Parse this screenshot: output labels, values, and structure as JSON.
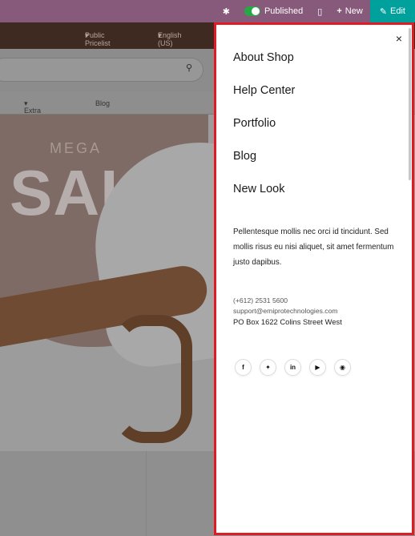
{
  "topbar": {
    "bug_icon": "bug-icon",
    "published_label": "Published",
    "mobile_icon": "mobile-icon",
    "new_label": "New",
    "edit_label": "Edit",
    "colors": {
      "bar": "#875a7b",
      "edit": "#00a09d",
      "toggle": "#28a745"
    }
  },
  "site_header": {
    "pricelist": "Public Pricelist",
    "language": "English (US)"
  },
  "menu": {
    "extra_pages": "Extra Pages",
    "blog": "Blog"
  },
  "hero": {
    "mega": "MEGA",
    "sale": "SALE"
  },
  "offcanvas": {
    "close_label": "×",
    "nav_items": [
      "About Shop",
      "Help Center",
      "Portfolio",
      "Blog",
      "New Look"
    ],
    "description": "Pellentesque mollis nec orci id tincidunt. Sed mollis risus eu nisi aliquet, sit amet fermentum justo dapibus.",
    "phone": "(+612) 2531 5600",
    "email": "support@emiprotechnologies.com",
    "address": "PO Box 1622 Colins Street West",
    "socials": [
      "facebook-icon",
      "twitter-icon",
      "linkedin-icon",
      "youtube-icon",
      "github-icon"
    ],
    "border_color": "#e01b24"
  }
}
